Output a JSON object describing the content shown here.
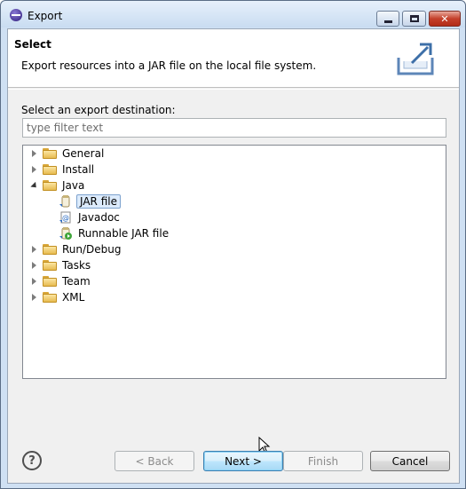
{
  "window": {
    "title": "Export",
    "controls": {
      "minimize_icon": "minimize-icon",
      "maximize_icon": "maximize-icon",
      "close_icon": "close-icon",
      "close_glyph": "✕"
    }
  },
  "header": {
    "title": "Select",
    "description": "Export resources into a JAR file on the local file system.",
    "banner_icon": "export-wizard-icon"
  },
  "destination": {
    "label": "Select an export destination:",
    "filter_placeholder": "type filter text",
    "filter_value": ""
  },
  "tree": {
    "items": [
      {
        "label": "General",
        "expanded": false,
        "icon": "folder-icon"
      },
      {
        "label": "Install",
        "expanded": false,
        "icon": "folder-icon"
      },
      {
        "label": "Java",
        "expanded": true,
        "icon": "folder-open-icon",
        "children": [
          {
            "label": "JAR file",
            "icon": "jar-file-icon",
            "selected": true
          },
          {
            "label": "Javadoc",
            "icon": "javadoc-icon"
          },
          {
            "label": "Runnable JAR file",
            "icon": "runnable-jar-icon"
          }
        ]
      },
      {
        "label": "Run/Debug",
        "expanded": false,
        "icon": "folder-icon"
      },
      {
        "label": "Tasks",
        "expanded": false,
        "icon": "folder-icon"
      },
      {
        "label": "Team",
        "expanded": false,
        "icon": "folder-icon"
      },
      {
        "label": "XML",
        "expanded": false,
        "icon": "folder-icon"
      }
    ]
  },
  "buttons": {
    "help_glyph": "?",
    "back": "< Back",
    "next": "Next >",
    "finish": "Finish",
    "cancel": "Cancel"
  },
  "colors": {
    "selection_bg": "#dcebfc",
    "selection_border": "#7da2ce",
    "folder": "#e7bb50"
  }
}
